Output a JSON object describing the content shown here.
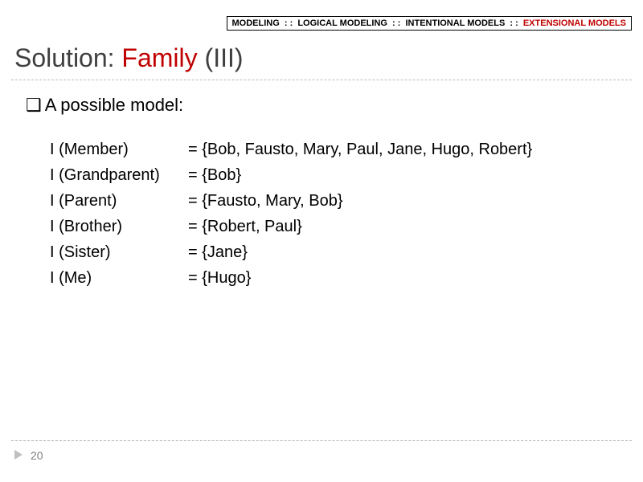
{
  "breadcrumb": {
    "items": [
      "MODELING",
      "LOGICAL MODELING",
      "INTENTIONAL MODELS",
      "EXTENSIONAL MODELS"
    ],
    "sep": ": :",
    "active_index": 3
  },
  "title": {
    "pre": "Solution: ",
    "accent": "Family",
    "post": " (III)"
  },
  "lead": {
    "bullet": "❑",
    "text": "A possible model:"
  },
  "model": [
    {
      "lhs": "I (Member)",
      "rhs": "= {Bob, Fausto, Mary, Paul, Jane, Hugo, Robert}"
    },
    {
      "lhs": "I (Grandparent)",
      "rhs": "= {Bob}"
    },
    {
      "lhs": "I (Parent)",
      "rhs": "= {Fausto, Mary, Bob}"
    },
    {
      "lhs": "I (Brother)",
      "rhs": "= {Robert, Paul}"
    },
    {
      "lhs": "I (Sister)",
      "rhs": "= {Jane}"
    },
    {
      "lhs": "I (Me)",
      "rhs": "= {Hugo}"
    }
  ],
  "page_number": "20"
}
